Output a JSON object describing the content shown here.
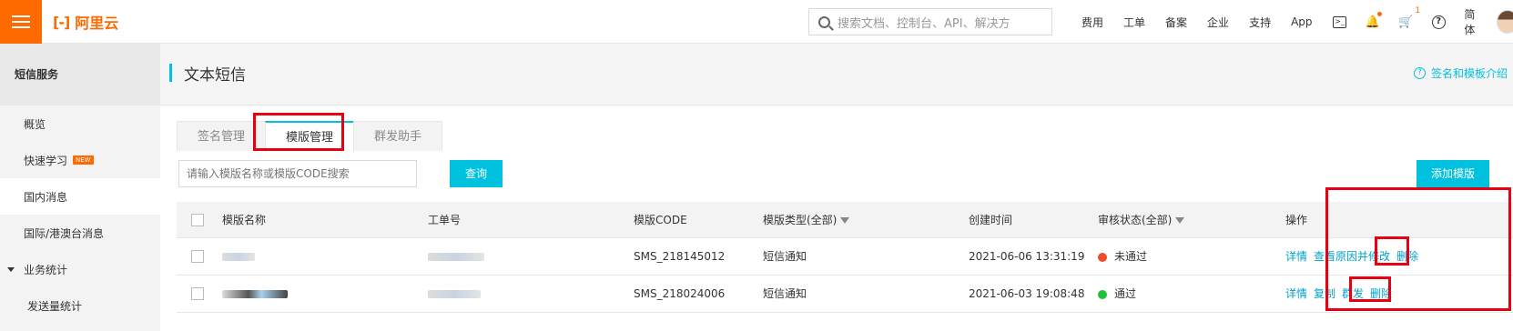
{
  "topbar": {
    "logo_text": "阿里云",
    "search_placeholder": "搜索文档、控制台、API、解决方",
    "nav": [
      "费用",
      "工单",
      "备案",
      "企业",
      "支持",
      "App"
    ],
    "cart_count": "1",
    "lang": "简体"
  },
  "sidebar": {
    "header": "短信服务",
    "items": [
      {
        "label": "概览"
      },
      {
        "label": "快速学习",
        "badge": "NEW"
      },
      {
        "label": "国内消息"
      },
      {
        "label": "国际/港澳台消息"
      },
      {
        "label": "业务统计"
      },
      {
        "label": "发送量统计"
      }
    ]
  },
  "main": {
    "title": "文本短信",
    "intro_link": "签名和模板介绍",
    "tabs": [
      "签名管理",
      "模版管理",
      "群发助手"
    ],
    "search_placeholder": "请输入模版名称或模版CODE搜索",
    "query_button": "查询",
    "add_button": "添加模版",
    "table": {
      "headers": [
        "模版名称",
        "工单号",
        "模版CODE",
        "模版类型(全部)",
        "创建时间",
        "审核状态(全部)",
        "操作"
      ],
      "rows": [
        {
          "code": "SMS_218145012",
          "type": "短信通知",
          "created": "2021-06-06 13:31:19",
          "status": "未通过",
          "status_color": "#f04d2a",
          "actions": [
            "详情",
            "查看原因并修改",
            "删除"
          ]
        },
        {
          "code": "SMS_218024006",
          "type": "短信通知",
          "created": "2021-06-03 19:08:48",
          "status": "通过",
          "status_color": "#1ec23a",
          "actions": [
            "详情",
            "复制",
            "群发",
            "删除"
          ]
        }
      ]
    }
  }
}
